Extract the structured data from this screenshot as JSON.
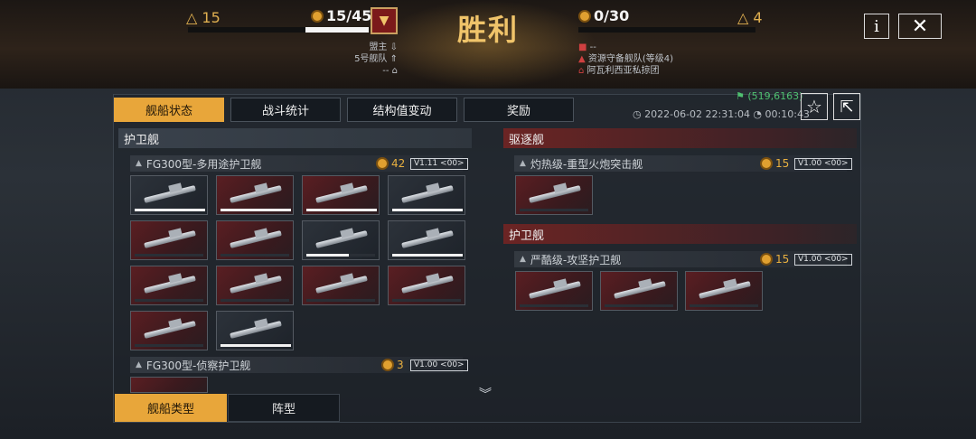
{
  "header": {
    "title": "胜利",
    "left": {
      "flag_count": "15",
      "score": "15/45",
      "bar_fill_fraction": 0.35,
      "info_lines": [
        "盟主",
        "5号舰队",
        "--"
      ]
    },
    "right": {
      "flag_count": "4",
      "score": "0/30",
      "bar_fill_fraction": 0.0,
      "info_lines": [
        "--",
        "资源守备舰队(等级4)",
        "阿瓦利西亚私掠团"
      ]
    },
    "info_button": "i",
    "close_button": "✕"
  },
  "tabs": [
    "舰船状态",
    "战斗统计",
    "结构值变动",
    "奖励"
  ],
  "active_tab": 0,
  "coords": "(519,6163)",
  "datetime": "2022-06-02 22:31:04",
  "duration": "00:10:43",
  "left_column": {
    "section": "护卫舰",
    "groups": [
      {
        "name": "FG300型-多用途护卫舰",
        "count": "42",
        "version": "V1.11 <00>",
        "ships": [
          {
            "style": "g",
            "hp": 1.0
          },
          {
            "style": "r",
            "hp": 1.0
          },
          {
            "style": "r",
            "hp": 1.0
          },
          {
            "style": "g",
            "hp": 1.0
          },
          {
            "style": "r",
            "hp": 0.0
          },
          {
            "style": "r",
            "hp": 0.0
          },
          {
            "style": "g",
            "hp": 0.6
          },
          {
            "style": "g",
            "hp": 1.0
          },
          {
            "style": "r",
            "hp": 0.0
          },
          {
            "style": "r",
            "hp": 0.0
          },
          {
            "style": "r",
            "hp": 0.0
          },
          {
            "style": "r",
            "hp": 0.0
          },
          {
            "style": "r",
            "hp": 0.0
          },
          {
            "style": "g",
            "hp": 1.0
          }
        ]
      },
      {
        "name": "FG300型-侦察护卫舰",
        "count": "3",
        "version": "V1.00 <00>"
      }
    ]
  },
  "right_column": [
    {
      "section": "驱逐舰",
      "group": {
        "name": "灼热级-重型火炮突击舰",
        "count": "15",
        "version": "V1.00 <00>",
        "ships": [
          {
            "style": "r",
            "hp": 0.0
          }
        ]
      }
    },
    {
      "section": "护卫舰",
      "group": {
        "name": "严酷级-攻坚护卫舰",
        "count": "15",
        "version": "V1.00 <00>",
        "ships": [
          {
            "style": "r",
            "hp": 0.0
          },
          {
            "style": "r",
            "hp": 0.0
          },
          {
            "style": "r",
            "hp": 0.0
          }
        ]
      }
    }
  ],
  "bottom_tabs": [
    "舰船类型",
    "阵型"
  ],
  "colors": {
    "accent": "#e8a63a",
    "victory": "#f0c46a",
    "coords": "#4fc070",
    "enemy": "#d04040"
  }
}
